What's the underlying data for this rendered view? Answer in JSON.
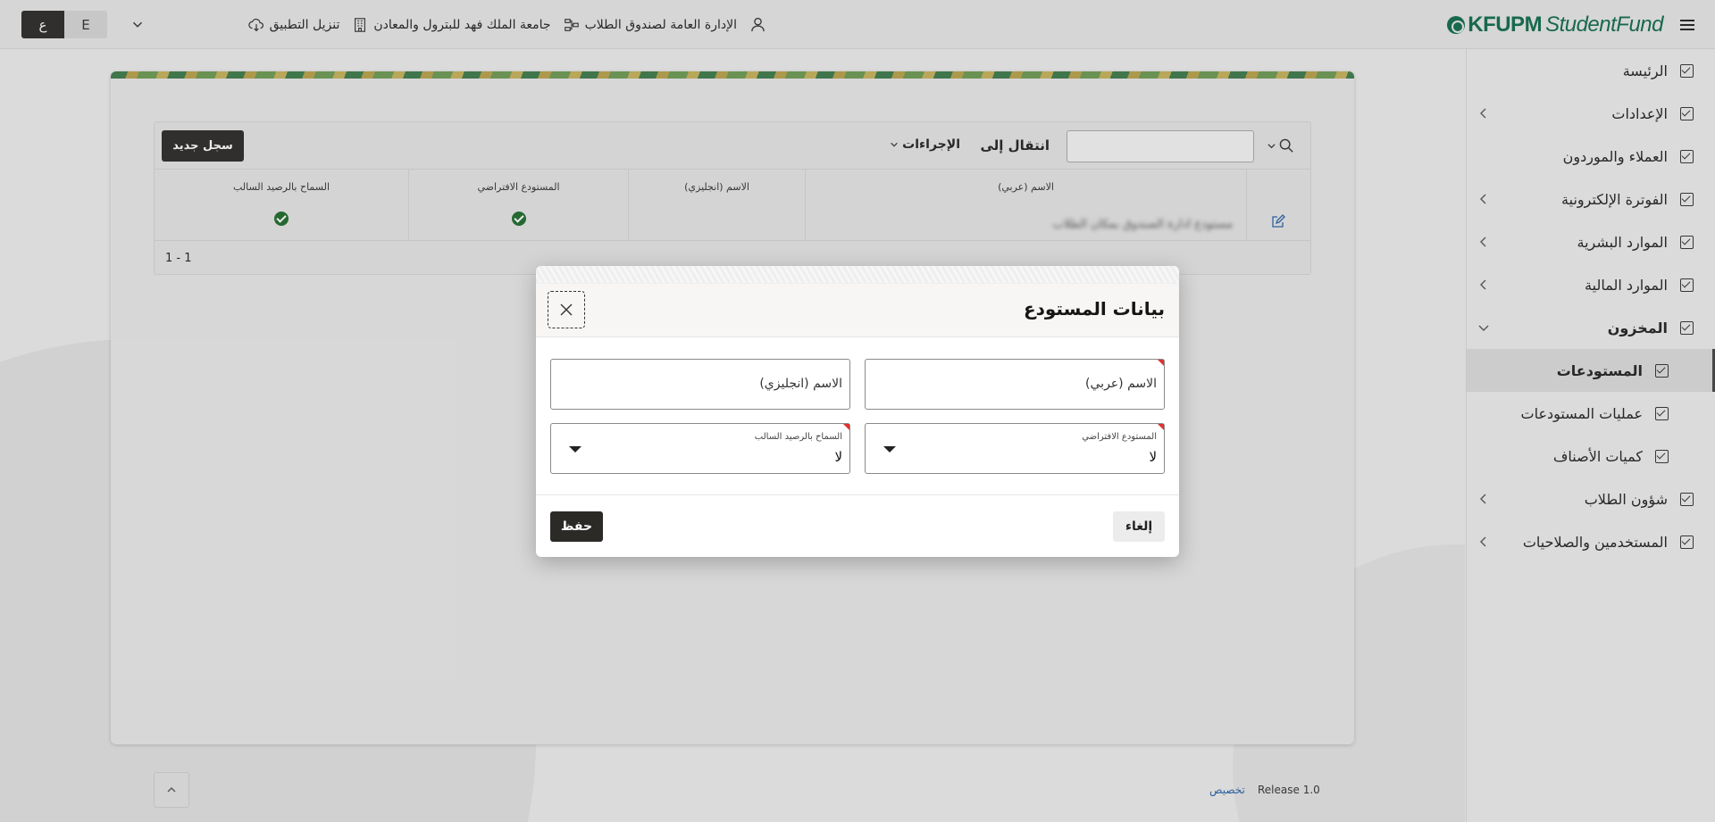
{
  "header": {
    "logo_bold": "KFUPM",
    "logo_rest": "StudentFund",
    "links": [
      {
        "label": "تنزيل التطبيق",
        "icon": "cloud-download-icon"
      },
      {
        "label": "جامعة الملك فهد للبترول والمعادن",
        "icon": "building-icon"
      },
      {
        "label": "الإدارة العامة لصندوق الطلاب",
        "icon": "org-chart-icon"
      }
    ],
    "user_icon": "user-icon",
    "lang_ar": "ع",
    "lang_en": "E"
  },
  "sidebar": {
    "items": [
      {
        "label": "الرئيسة",
        "expandable": false
      },
      {
        "label": "الإعدادات",
        "expandable": true
      },
      {
        "label": "العملاء والموردون",
        "expandable": false
      },
      {
        "label": "الفوترة الإلكترونية",
        "expandable": true
      },
      {
        "label": "الموارد البشرية",
        "expandable": true
      },
      {
        "label": "الموارد المالية",
        "expandable": true
      },
      {
        "label": "المخزون",
        "expandable": true,
        "expanded": true
      },
      {
        "label": "المستودعات",
        "sub": true,
        "active": true
      },
      {
        "label": "عمليات المستودعات",
        "sub": true
      },
      {
        "label": "كميات الأصناف",
        "sub": true
      },
      {
        "label": "شؤون الطلاب",
        "expandable": true
      },
      {
        "label": "المستخدمين والصلاحيات",
        "expandable": true
      }
    ]
  },
  "grid": {
    "search_value": "",
    "goto_label": "انتقال إلى",
    "actions_label": "الإجراءات",
    "new_record_label": "سجل جديد",
    "columns": [
      "الاسم (عربي)",
      "الاسم (انجليزي)",
      "المستودع الافتراضي",
      "السماح بالرصيد السالب"
    ],
    "rows": [
      {
        "name_ar": "مستودع ادارة الصندوق بمكان الطلاب",
        "name_en": "",
        "default_warehouse": true,
        "allow_negative": true
      }
    ],
    "pagination": "1 - 1"
  },
  "footer": {
    "release": "Release 1.0",
    "customize": "تخصيص"
  },
  "dialog": {
    "title": "بيانات المستودع",
    "fields": {
      "name_ar_placeholder": "الاسم (عربي)",
      "name_en_placeholder": "الاسم (انجليزي)",
      "default_label": "المستودع الافتراضي",
      "default_value": "لا",
      "negative_label": "السماح بالرصيد السالب",
      "negative_value": "لا"
    },
    "cancel_label": "إلغاء",
    "save_label": "حفظ"
  },
  "colors": {
    "brand_green": "#0f6b4b",
    "dark_button": "#2b2a27",
    "required_marker": "#dd3333",
    "check_green": "#1e6b2c"
  }
}
